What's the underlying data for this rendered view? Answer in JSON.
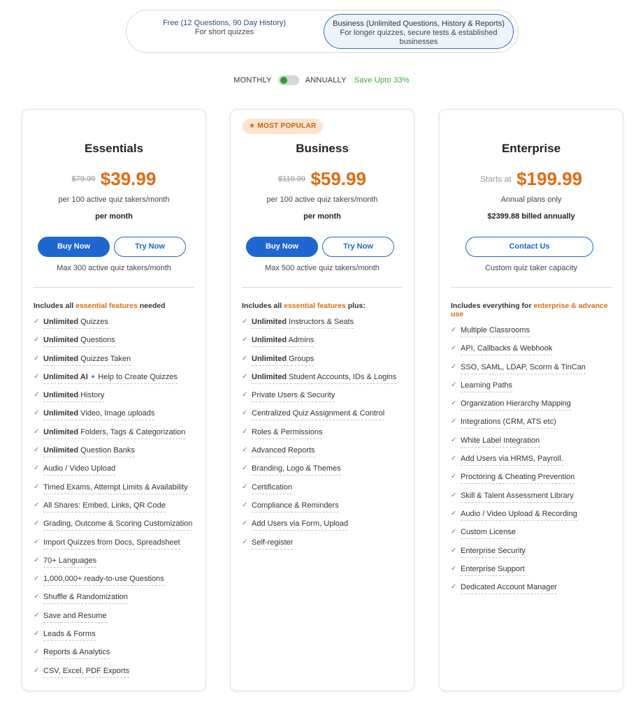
{
  "plans": {
    "free": {
      "title": "Free (12 Questions, 90 Day History)",
      "sub": "For short quizzes"
    },
    "business": {
      "title": "Business (Unlimited Questions, History & Reports)",
      "sub": "For longer quizzes, secure tests & established businesses"
    }
  },
  "billing": {
    "monthly": "MONTHLY",
    "annually": "ANNUALLY",
    "save": "Save Upto 33%",
    "selected": "monthly"
  },
  "colors": {
    "accent": "#1e66d0",
    "price": "#e06b12",
    "check": "#3aa63a",
    "badge_bg": "#fde3cf"
  },
  "cards": {
    "essentials": {
      "name": "Essentials",
      "old_price": "$79.99",
      "price": "$39.99",
      "per_line": "per 100 active quiz takers/month",
      "per_month": "per month",
      "buy_label": "Buy Now",
      "try_label": "Try Now",
      "capacity": "Max 300 active quiz takers/month",
      "includes_pre": "Includes all ",
      "includes_hl": "essential features",
      "includes_post": " needed",
      "features": [
        {
          "bold": "Unlimited",
          "text": " Quizzes"
        },
        {
          "bold": "Unlimited",
          "text": " Questions"
        },
        {
          "bold": "Unlimited",
          "text": " Quizzes Taken"
        },
        {
          "bold": "Unlimited AI",
          "text": " Help to Create Quizzes",
          "spark": "✦"
        },
        {
          "bold": "Unlimited",
          "text": " History"
        },
        {
          "bold": "Unlimited",
          "text": " Video, Image uploads"
        },
        {
          "bold": "Unlimited",
          "text": " Folders, Tags & Categorization"
        },
        {
          "bold": "Unlimited",
          "text": " Question Banks"
        },
        {
          "bold": "",
          "text": "Audio / Video Upload"
        },
        {
          "bold": "",
          "text": "Timed Exams, Attempt Limits & Availability"
        },
        {
          "bold": "",
          "text": "All Shares: Embed, Links, QR Code"
        },
        {
          "bold": "",
          "text": "Grading, Outcome & Scoring Customization"
        },
        {
          "bold": "",
          "text": "Import Quizzes from Docs, Spreadsheet"
        },
        {
          "bold": "",
          "text": "70+ Languages"
        },
        {
          "bold": "",
          "text": "1,000,000+ ready-to-use Questions"
        },
        {
          "bold": "",
          "text": "Shuffle & Randomization"
        },
        {
          "bold": "",
          "text": "Save and Resume"
        },
        {
          "bold": "",
          "text": "Leads & Forms"
        },
        {
          "bold": "",
          "text": "Reports & Analytics"
        },
        {
          "bold": "",
          "text": "CSV, Excel, PDF Exports"
        }
      ]
    },
    "business": {
      "badge": "★ MOST POPULAR",
      "name": "Business",
      "old_price": "$119.99",
      "price": "$59.99",
      "per_line": "per 100 active quiz takers/month",
      "per_month": "per month",
      "buy_label": "Buy Now",
      "try_label": "Try Now",
      "capacity": "Max 500 active quiz takers/month",
      "includes_pre": "Includes all ",
      "includes_hl": "essential features",
      "includes_post": " plus:",
      "features": [
        {
          "bold": "Unlimited",
          "text": " Instructors & Seats"
        },
        {
          "bold": "Unlimited",
          "text": " Admins"
        },
        {
          "bold": "Unlimited",
          "text": " Groups"
        },
        {
          "bold": "Unlimited",
          "text": " Student Accounts, IDs & Logins"
        },
        {
          "bold": "",
          "text": "Private Users & Security"
        },
        {
          "bold": "",
          "text": "Centralized Quiz Assignment & Control"
        },
        {
          "bold": "",
          "text": "Roles & Permissions"
        },
        {
          "bold": "",
          "text": "Advanced Reports"
        },
        {
          "bold": "",
          "text": "Branding, Logo & Themes"
        },
        {
          "bold": "",
          "text": "Certification"
        },
        {
          "bold": "",
          "text": "Compliance & Reminders"
        },
        {
          "bold": "",
          "text": "Add Users via Form, Upload"
        },
        {
          "bold": "",
          "text": "Self-register"
        }
      ]
    },
    "enterprise": {
      "name": "Enterprise",
      "starts_at": "Starts at",
      "price": "$199.99",
      "per_line": "Annual plans only",
      "per_month": "$2399.88 billed annually",
      "contact_label": "Contact Us",
      "capacity": "Custom quiz taker capacity",
      "includes_pre": "Includes everything for ",
      "includes_hl": "enterprise & advance use",
      "includes_post": "",
      "features": [
        {
          "bold": "",
          "text": "Multiple Classrooms"
        },
        {
          "bold": "",
          "text": "API, Callbacks & Webhook"
        },
        {
          "bold": "",
          "text": "SSO, SAML, LDAP, Scorm & TinCan"
        },
        {
          "bold": "",
          "text": "Learning Paths"
        },
        {
          "bold": "",
          "text": "Organization Hierarchy Mapping"
        },
        {
          "bold": "",
          "text": "Integrations (CRM, ATS etc)"
        },
        {
          "bold": "",
          "text": "White Label Integration"
        },
        {
          "bold": "",
          "text": "Add Users via HRMS, Payroll."
        },
        {
          "bold": "",
          "text": "Proctoring & Cheating Prevention"
        },
        {
          "bold": "",
          "text": "Skill & Talent Assessment Library"
        },
        {
          "bold": "",
          "text": "Audio / Video Upload & Recording"
        },
        {
          "bold": "",
          "text": "Custom License"
        },
        {
          "bold": "",
          "text": "Enterprise Security"
        },
        {
          "bold": "",
          "text": "Enterprise Support"
        },
        {
          "bold": "",
          "text": "Dedicated Account Manager"
        }
      ]
    }
  }
}
